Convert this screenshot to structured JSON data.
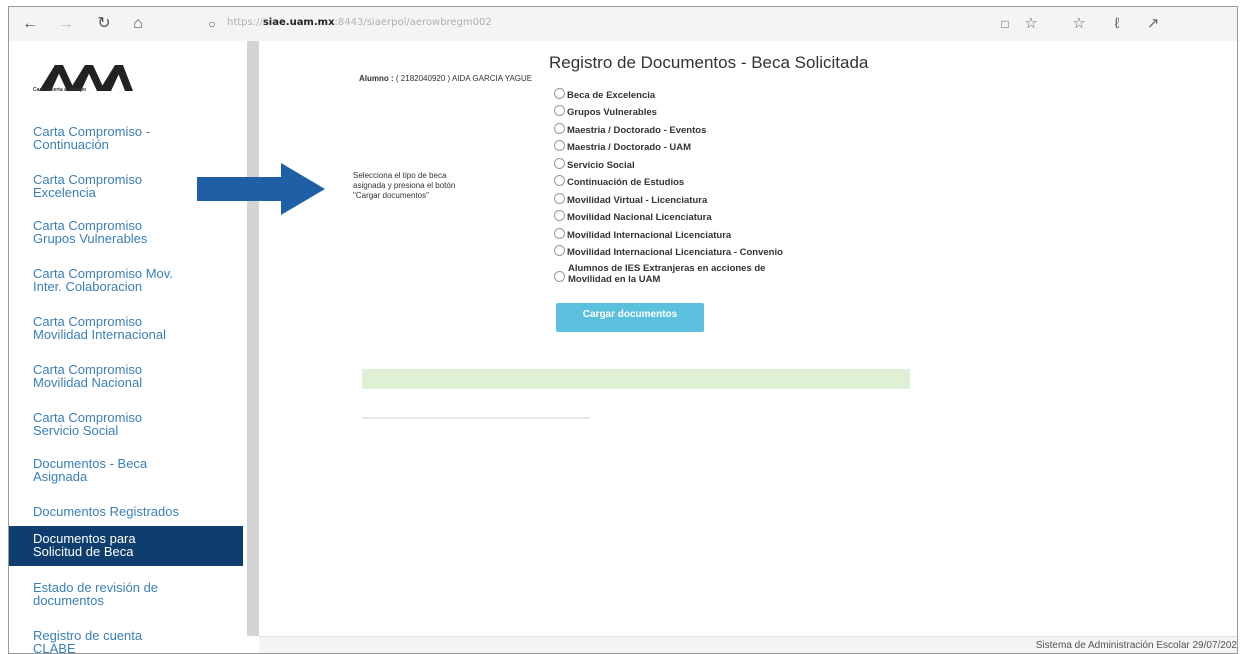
{
  "browser": {
    "url_prefix": "https://",
    "url_domain": "siae.uam.mx",
    "url_rest": ":8443/siaerpol/aerowbregm002",
    "icons": [
      "back-icon",
      "forward-icon",
      "refresh-icon",
      "home-icon",
      "lock-icon",
      "reading-view-icon",
      "favorite-icon",
      "favorites-list-icon",
      "pen-icon",
      "share-icon"
    ]
  },
  "logo": {
    "tagline": "Casa abierta al tiempo"
  },
  "sidebar": {
    "items": [
      {
        "line1": "Carta Compromiso -",
        "line2": "Continuación"
      },
      {
        "line1": "Carta Compromiso",
        "line2": "Excelencia"
      },
      {
        "line1": "Carta Compromiso",
        "line2": "Grupos Vulnerables"
      },
      {
        "line1": "Carta Compromiso Mov.",
        "line2": "Inter. Colaboracion"
      },
      {
        "line1": "Carta Compromiso",
        "line2": "Movilidad Internacional"
      },
      {
        "line1": "Carta Compromiso",
        "line2": "Movilidad Nacional"
      },
      {
        "line1": "Carta Compromiso",
        "line2": "Servicio Social"
      },
      {
        "line1": "Documentos - Beca",
        "line2": "Asignada"
      },
      {
        "line1": "Documentos Registrados",
        "line2": ""
      },
      {
        "line1": "Documentos para",
        "line2": "Solicitud de Beca"
      },
      {
        "line1": "Estado de revisión de",
        "line2": "documentos"
      },
      {
        "line1": "Registro de cuenta",
        "line2": "CLABE"
      }
    ],
    "active_index": 9
  },
  "main": {
    "title": "Registro de Documentos - Beca Solicitada",
    "alumno_label": "Alumno :",
    "alumno_value": "( 2182040920 ) AIDA GARCIA YAGUE",
    "instruction_line1": "Selecciona el tipo de beca",
    "instruction_line2": "asignada y presiona el botón",
    "instruction_line3": "\"Cargar documentos\"",
    "options": [
      "Beca de Excelencia",
      "Grupos Vulnerables",
      "Maestria / Doctorado - Eventos",
      "Maestria / Doctorado - UAM",
      "Servicio Social",
      "Continuación de Estudios",
      "Movilidad Virtual - Licenciatura",
      "Movilidad Nacional Licenciatura",
      "Movilidad Internacional Licenciatura",
      "Movilidad Internacional Licenciatura - Convenio"
    ],
    "option_multiline_line1": "Alumnos de IES Extranjeras en acciones de",
    "option_multiline_line2": "Movilidad en la UAM",
    "button_label": "Cargar documentos"
  },
  "footer": {
    "text": "Sistema de Administración Escolar 29/07/202"
  },
  "colors": {
    "accent": "#5bc0de",
    "active_nav": "#0d3e6e",
    "link": "#3a7fb8",
    "arrow": "#1f5fa6"
  }
}
